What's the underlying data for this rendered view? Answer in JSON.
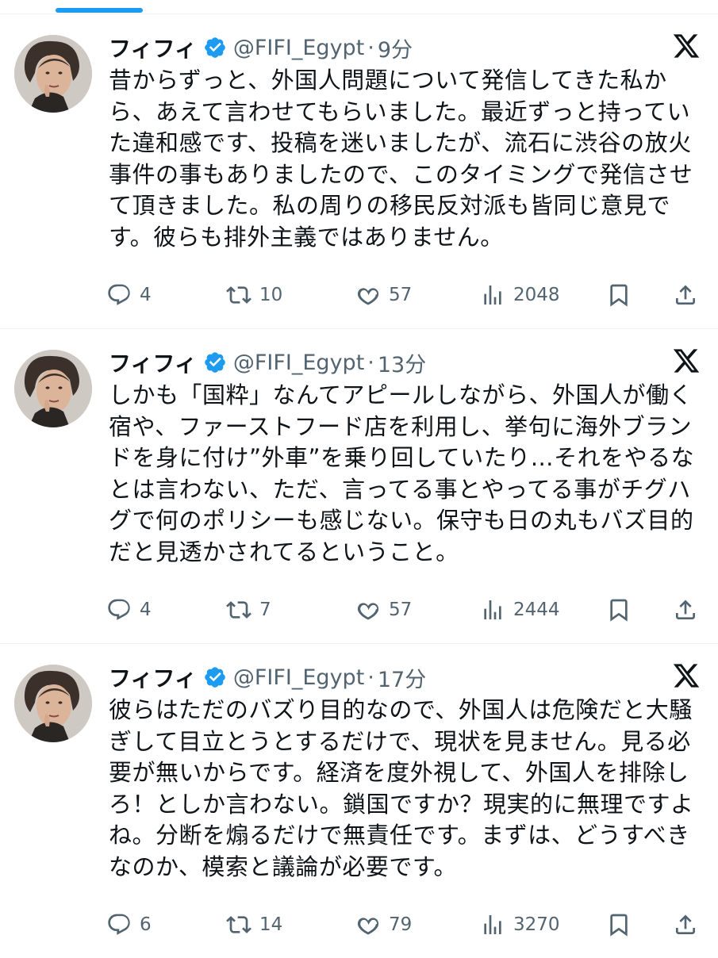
{
  "tweets": [
    {
      "display_name": "フィフィ",
      "handle": "@FIFI_Egypt",
      "separator": "·",
      "time": "9分",
      "text": "昔からずっと、外国人問題について発信してきた私から、あえて言わせてもらいました。最近ずっと持っていた違和感です、投稿を迷いましたが、流石に渋谷の放火事件の事もありましたので、このタイミングで発信させて頂きました。私の周りの移民反対派も皆同じ意見です。彼らも排外主義ではありません。",
      "replies": "4",
      "reposts": "10",
      "likes": "57",
      "views": "2048"
    },
    {
      "display_name": "フィフィ",
      "handle": "@FIFI_Egypt",
      "separator": "·",
      "time": "13分",
      "text": "しかも「国粋」なんてアピールしながら、外国人が働く宿や、ファーストフード店を利用し、挙句に海外ブランドを身に付け”外車”を乗り回していたり…それをやるなとは言わない、ただ、言ってる事とやってる事がチグハグで何のポリシーも感じない。保守も日の丸もバズ目的だと見透かされてるということ。",
      "replies": "4",
      "reposts": "7",
      "likes": "57",
      "views": "2444"
    },
    {
      "display_name": "フィフィ",
      "handle": "@FIFI_Egypt",
      "separator": "·",
      "time": "17分",
      "text": "彼らはただのバズり目的なので、外国人は危険だと大騒ぎして目立とうとするだけで、現状を見ません。見る必要が無いからです。経済を度外視して、外国人を排除しろ！としか言わない。鎖国ですか？現実的に無理ですよね。分断を煽るだけで無責任です。まずは、どうすべきなのか、模索と議論が必要です。",
      "replies": "6",
      "reposts": "14",
      "likes": "79",
      "views": "3270"
    }
  ],
  "icons": {
    "verified": "verified-badge-icon",
    "platform": "x-logo-icon",
    "reply": "reply-icon",
    "repost": "repost-icon",
    "like": "heart-icon",
    "views": "views-icon",
    "bookmark": "bookmark-icon",
    "share": "share-icon"
  },
  "colors": {
    "accent": "#1d9bf0",
    "secondary_text": "#536471",
    "divider": "#eff3f4"
  }
}
